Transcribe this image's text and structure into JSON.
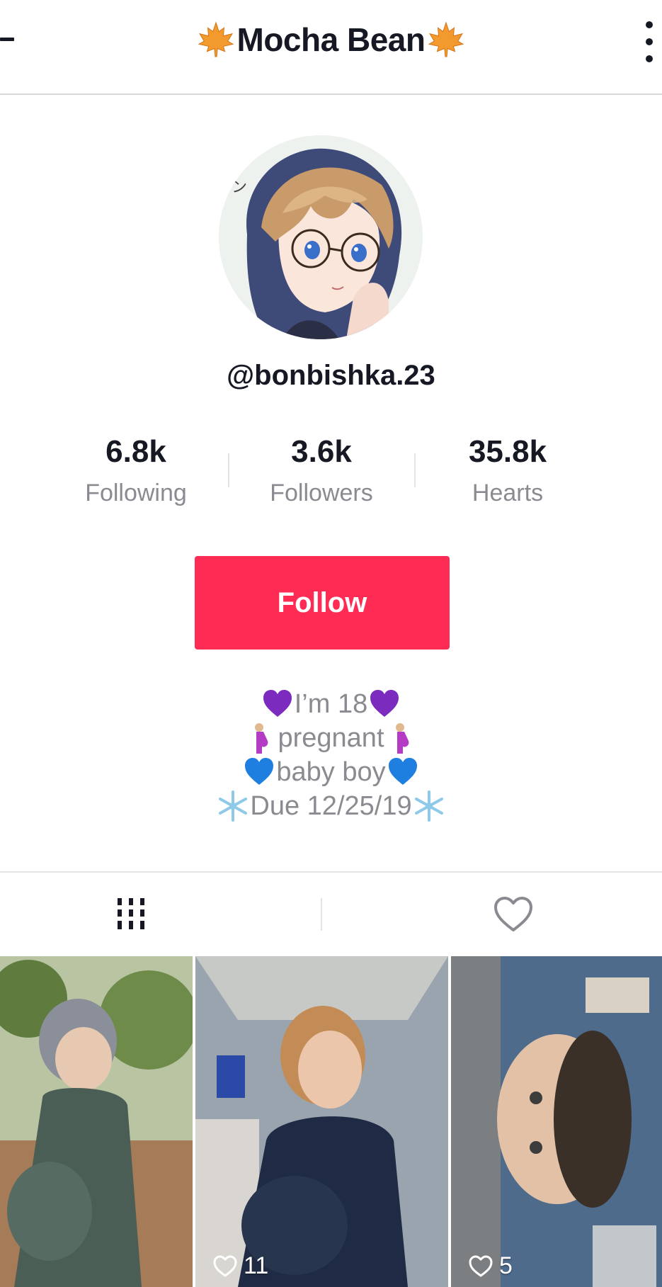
{
  "header": {
    "title": "Mocha Bean",
    "title_left_icon": "maple-leaf-icon",
    "title_right_icon": "maple-leaf-icon"
  },
  "profile": {
    "username": "@bonbishka.23"
  },
  "stats": [
    {
      "value": "6.8k",
      "label": "Following"
    },
    {
      "value": "3.6k",
      "label": "Followers"
    },
    {
      "value": "35.8k",
      "label": "Hearts"
    }
  ],
  "actions": {
    "follow_label": "Follow",
    "follow_color": "#fe2c55"
  },
  "bio": {
    "line1": "I’m 18",
    "line2": "pregnant",
    "line3": "baby boy",
    "line4": "Due 12/25/19"
  },
  "tabs": {
    "videos_icon": "grid-icon",
    "liked_icon": "heart-outline-icon"
  },
  "videos": [
    {
      "likes": ""
    },
    {
      "likes": "11"
    },
    {
      "likes": "5"
    }
  ]
}
